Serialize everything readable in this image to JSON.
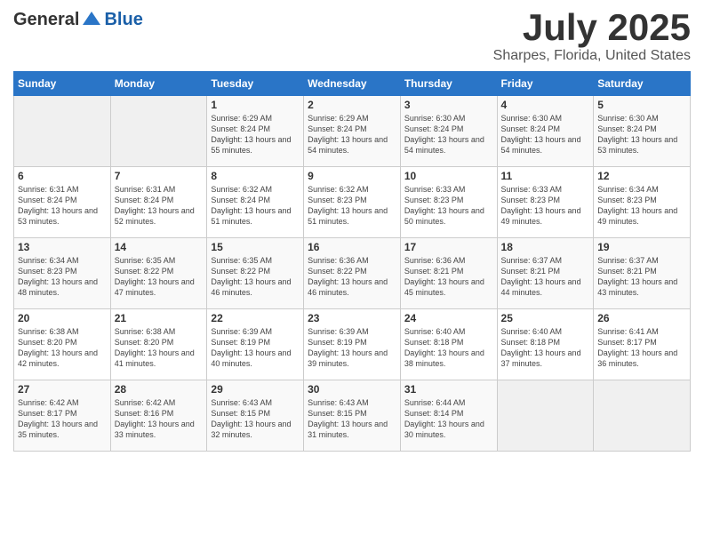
{
  "header": {
    "logo_general": "General",
    "logo_blue": "Blue",
    "month": "July 2025",
    "location": "Sharpes, Florida, United States"
  },
  "days_of_week": [
    "Sunday",
    "Monday",
    "Tuesday",
    "Wednesday",
    "Thursday",
    "Friday",
    "Saturday"
  ],
  "weeks": [
    [
      {
        "day": "",
        "sunrise": "",
        "sunset": "",
        "daylight": ""
      },
      {
        "day": "",
        "sunrise": "",
        "sunset": "",
        "daylight": ""
      },
      {
        "day": "1",
        "sunrise": "Sunrise: 6:29 AM",
        "sunset": "Sunset: 8:24 PM",
        "daylight": "Daylight: 13 hours and 55 minutes."
      },
      {
        "day": "2",
        "sunrise": "Sunrise: 6:29 AM",
        "sunset": "Sunset: 8:24 PM",
        "daylight": "Daylight: 13 hours and 54 minutes."
      },
      {
        "day": "3",
        "sunrise": "Sunrise: 6:30 AM",
        "sunset": "Sunset: 8:24 PM",
        "daylight": "Daylight: 13 hours and 54 minutes."
      },
      {
        "day": "4",
        "sunrise": "Sunrise: 6:30 AM",
        "sunset": "Sunset: 8:24 PM",
        "daylight": "Daylight: 13 hours and 54 minutes."
      },
      {
        "day": "5",
        "sunrise": "Sunrise: 6:30 AM",
        "sunset": "Sunset: 8:24 PM",
        "daylight": "Daylight: 13 hours and 53 minutes."
      }
    ],
    [
      {
        "day": "6",
        "sunrise": "Sunrise: 6:31 AM",
        "sunset": "Sunset: 8:24 PM",
        "daylight": "Daylight: 13 hours and 53 minutes."
      },
      {
        "day": "7",
        "sunrise": "Sunrise: 6:31 AM",
        "sunset": "Sunset: 8:24 PM",
        "daylight": "Daylight: 13 hours and 52 minutes."
      },
      {
        "day": "8",
        "sunrise": "Sunrise: 6:32 AM",
        "sunset": "Sunset: 8:24 PM",
        "daylight": "Daylight: 13 hours and 51 minutes."
      },
      {
        "day": "9",
        "sunrise": "Sunrise: 6:32 AM",
        "sunset": "Sunset: 8:23 PM",
        "daylight": "Daylight: 13 hours and 51 minutes."
      },
      {
        "day": "10",
        "sunrise": "Sunrise: 6:33 AM",
        "sunset": "Sunset: 8:23 PM",
        "daylight": "Daylight: 13 hours and 50 minutes."
      },
      {
        "day": "11",
        "sunrise": "Sunrise: 6:33 AM",
        "sunset": "Sunset: 8:23 PM",
        "daylight": "Daylight: 13 hours and 49 minutes."
      },
      {
        "day": "12",
        "sunrise": "Sunrise: 6:34 AM",
        "sunset": "Sunset: 8:23 PM",
        "daylight": "Daylight: 13 hours and 49 minutes."
      }
    ],
    [
      {
        "day": "13",
        "sunrise": "Sunrise: 6:34 AM",
        "sunset": "Sunset: 8:23 PM",
        "daylight": "Daylight: 13 hours and 48 minutes."
      },
      {
        "day": "14",
        "sunrise": "Sunrise: 6:35 AM",
        "sunset": "Sunset: 8:22 PM",
        "daylight": "Daylight: 13 hours and 47 minutes."
      },
      {
        "day": "15",
        "sunrise": "Sunrise: 6:35 AM",
        "sunset": "Sunset: 8:22 PM",
        "daylight": "Daylight: 13 hours and 46 minutes."
      },
      {
        "day": "16",
        "sunrise": "Sunrise: 6:36 AM",
        "sunset": "Sunset: 8:22 PM",
        "daylight": "Daylight: 13 hours and 46 minutes."
      },
      {
        "day": "17",
        "sunrise": "Sunrise: 6:36 AM",
        "sunset": "Sunset: 8:21 PM",
        "daylight": "Daylight: 13 hours and 45 minutes."
      },
      {
        "day": "18",
        "sunrise": "Sunrise: 6:37 AM",
        "sunset": "Sunset: 8:21 PM",
        "daylight": "Daylight: 13 hours and 44 minutes."
      },
      {
        "day": "19",
        "sunrise": "Sunrise: 6:37 AM",
        "sunset": "Sunset: 8:21 PM",
        "daylight": "Daylight: 13 hours and 43 minutes."
      }
    ],
    [
      {
        "day": "20",
        "sunrise": "Sunrise: 6:38 AM",
        "sunset": "Sunset: 8:20 PM",
        "daylight": "Daylight: 13 hours and 42 minutes."
      },
      {
        "day": "21",
        "sunrise": "Sunrise: 6:38 AM",
        "sunset": "Sunset: 8:20 PM",
        "daylight": "Daylight: 13 hours and 41 minutes."
      },
      {
        "day": "22",
        "sunrise": "Sunrise: 6:39 AM",
        "sunset": "Sunset: 8:19 PM",
        "daylight": "Daylight: 13 hours and 40 minutes."
      },
      {
        "day": "23",
        "sunrise": "Sunrise: 6:39 AM",
        "sunset": "Sunset: 8:19 PM",
        "daylight": "Daylight: 13 hours and 39 minutes."
      },
      {
        "day": "24",
        "sunrise": "Sunrise: 6:40 AM",
        "sunset": "Sunset: 8:18 PM",
        "daylight": "Daylight: 13 hours and 38 minutes."
      },
      {
        "day": "25",
        "sunrise": "Sunrise: 6:40 AM",
        "sunset": "Sunset: 8:18 PM",
        "daylight": "Daylight: 13 hours and 37 minutes."
      },
      {
        "day": "26",
        "sunrise": "Sunrise: 6:41 AM",
        "sunset": "Sunset: 8:17 PM",
        "daylight": "Daylight: 13 hours and 36 minutes."
      }
    ],
    [
      {
        "day": "27",
        "sunrise": "Sunrise: 6:42 AM",
        "sunset": "Sunset: 8:17 PM",
        "daylight": "Daylight: 13 hours and 35 minutes."
      },
      {
        "day": "28",
        "sunrise": "Sunrise: 6:42 AM",
        "sunset": "Sunset: 8:16 PM",
        "daylight": "Daylight: 13 hours and 33 minutes."
      },
      {
        "day": "29",
        "sunrise": "Sunrise: 6:43 AM",
        "sunset": "Sunset: 8:15 PM",
        "daylight": "Daylight: 13 hours and 32 minutes."
      },
      {
        "day": "30",
        "sunrise": "Sunrise: 6:43 AM",
        "sunset": "Sunset: 8:15 PM",
        "daylight": "Daylight: 13 hours and 31 minutes."
      },
      {
        "day": "31",
        "sunrise": "Sunrise: 6:44 AM",
        "sunset": "Sunset: 8:14 PM",
        "daylight": "Daylight: 13 hours and 30 minutes."
      },
      {
        "day": "",
        "sunrise": "",
        "sunset": "",
        "daylight": ""
      },
      {
        "day": "",
        "sunrise": "",
        "sunset": "",
        "daylight": ""
      }
    ]
  ]
}
